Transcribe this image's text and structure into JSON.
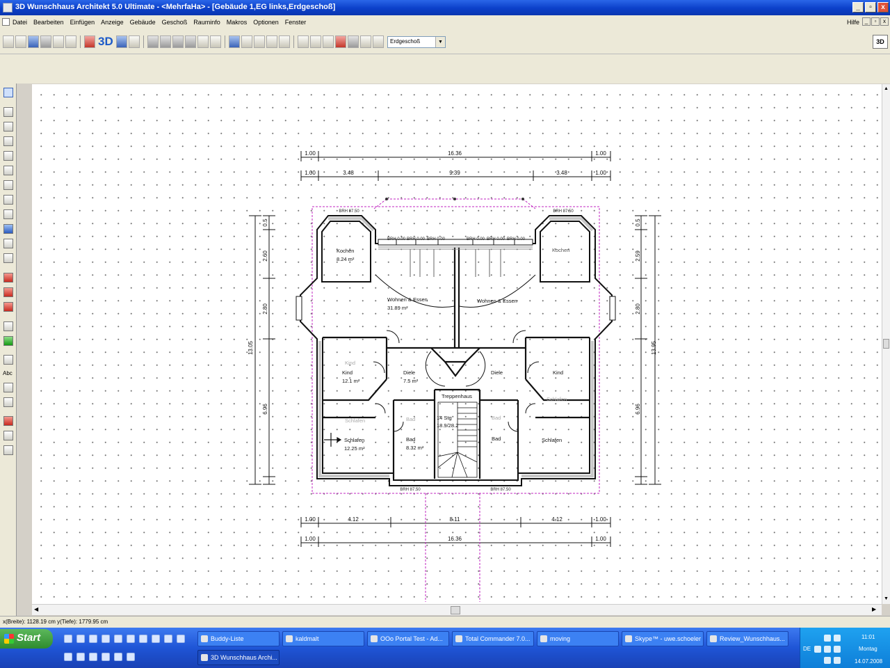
{
  "window": {
    "title": "3D Wunschhaus Architekt 5.0 Ultimate - <MehrfaHa> - [Gebäude 1,EG links,Erdgeschoß]",
    "controls": [
      "_",
      "▫",
      "x"
    ]
  },
  "menu": {
    "items": [
      "Datei",
      "Bearbeiten",
      "Einfügen",
      "Anzeige",
      "Gebäude",
      "Geschoß",
      "Rauminfo",
      "Makros",
      "Optionen",
      "Fenster"
    ],
    "help": "Hilfe"
  },
  "toolbar": {
    "label_3d": "3D",
    "floor_select": "Erdgeschoß",
    "right_button": "3D"
  },
  "plan": {
    "top_dims_outer": [
      "1.00",
      "16.36",
      "1.00"
    ],
    "top_dims_inner": [
      "1.00",
      "3.48",
      "9.39",
      "3.48",
      "1.00"
    ],
    "bottom_dims_inner": [
      "1.00",
      "4.12",
      "8.11",
      "4.12",
      "1.00"
    ],
    "bottom_dims_outer": [
      "1.00",
      "16.36",
      "1.00"
    ],
    "left_dims": [
      "13.05",
      "2.60",
      "2.80",
      "6.96",
      "0.5"
    ],
    "right_dims": [
      "13.95",
      "2.59",
      "2.80",
      "6.96",
      "0.5"
    ],
    "brh_labels": [
      "BRH 0.00",
      "BRH 0.00",
      "BRH 0.00",
      "BRH 0.00",
      "BRH 0.00",
      "BRH 0.00",
      "BRH 0.00",
      "BRH 87.50",
      "BRH 87.50",
      "BRH 87.50",
      "BRH 87.50"
    ],
    "rooms": {
      "kitchen_left": "Kochen",
      "kitchen_left_area": "8.24 m²",
      "kitchen_right": "Kochen",
      "living_left": "Wohnen & Essen",
      "living_left_area": "31.89 m²",
      "living_right": "Wohnen & Essen",
      "kind_left_ghost": "Kind",
      "kind_left": "Kind",
      "kind_left_area": "12.1 m²",
      "kind_right": "Kind",
      "diele_left": "Diele",
      "diele_left_area": "7.5 m²",
      "diele_right": "Diele",
      "stair": "Treppenhaus",
      "stair_info_1": "14 Stg",
      "stair_info_2": "18.9/28.2",
      "bad_left_ghost": "Bad",
      "bad_left": "Bad",
      "bad_left_area": "8.32 m²",
      "bad_right_ghost": "Bad",
      "bad_right": "Bad",
      "schlafen_left_ghost": "Schlafen",
      "schlafen_left": "Schlafen",
      "schlafen_left_area": "12.25 m²",
      "schlafen_right_ghost": "Schlafen",
      "schlafen_right": "Schlafen"
    }
  },
  "status": {
    "coords": "x(Breite): 1128.19 cm   y(Tiefe): 1779.95 cm"
  },
  "taskbar": {
    "start": "Start",
    "tasks": [
      "Buddy-Liste",
      "kaldmalt",
      "OOo Portal Test - Ad...",
      "Total Commander 7.0...",
      "moving",
      "Skype™ - uwe.schoeler",
      "Review_Wunschhaus...",
      "3D Wunschhaus Archi..."
    ],
    "tray_lang": "DE",
    "clock_time": "11:01",
    "clock_day": "Montag",
    "clock_date": "14.07.2008"
  }
}
